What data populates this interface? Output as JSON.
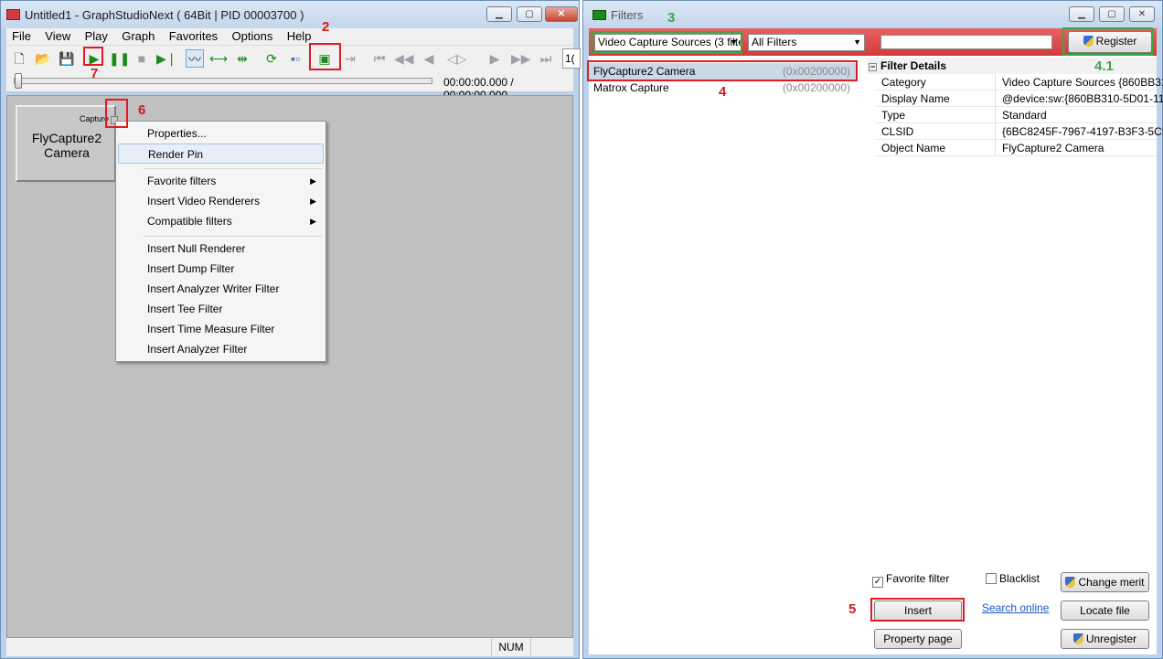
{
  "main_window": {
    "title": "Untitled1 - GraphStudioNext ( 64Bit | PID 00003700 )",
    "menu": [
      "File",
      "View",
      "Play",
      "Graph",
      "Favorites",
      "Options",
      "Help"
    ],
    "time_display": "00:00:00.000 / 00:00:00.000",
    "toolbar_overflow": "1(",
    "status": "NUM"
  },
  "filter_node": {
    "name": "FlyCapture2 Camera",
    "pin_label": "Capture"
  },
  "context_menu": {
    "items": [
      {
        "label": "Properties..."
      },
      {
        "label": "Render Pin"
      },
      {
        "label": "Favorite filters"
      },
      {
        "label": "Insert Video Renderers"
      },
      {
        "label": "Compatible filters"
      },
      {
        "label": "Insert Null Renderer"
      },
      {
        "label": "Insert Dump Filter"
      },
      {
        "label": "Insert Analyzer Writer Filter"
      },
      {
        "label": "Insert Tee Filter"
      },
      {
        "label": "Insert Time Measure Filter"
      },
      {
        "label": "Insert Analyzer Filter"
      }
    ]
  },
  "filters_window": {
    "title": "Filters",
    "category_combo": "Video Capture Sources (3 filte",
    "type_combo": "All Filters",
    "search_value": "",
    "register_label": "Register",
    "list": [
      {
        "name": "FlyCapture2 Camera",
        "merit": "(0x00200000)"
      },
      {
        "name": "Matrox Capture",
        "merit": "(0x00200000)"
      }
    ],
    "details_header": "Filter Details",
    "details": [
      {
        "key": "Category",
        "value": "Video Capture Sources {860BB310-"
      },
      {
        "key": "Display Name",
        "value": "@device:sw:{860BB310-5D01-11D0"
      },
      {
        "key": "Type",
        "value": "Standard"
      },
      {
        "key": "CLSID",
        "value": "{6BC8245F-7967-4197-B3F3-5CD16"
      },
      {
        "key": "Object Name",
        "value": "FlyCapture2 Camera"
      }
    ],
    "favorite_label": "Favorite filter",
    "blacklist_label": "Blacklist",
    "change_merit_label": "Change merit",
    "insert_label": "Insert",
    "search_online_label": "Search online",
    "locate_file_label": "Locate file",
    "property_page_label": "Property page",
    "unregister_label": "Unregister"
  },
  "annotations": {
    "a2": "2",
    "a3": "3",
    "a4": "4",
    "a41": "4.1",
    "a5": "5",
    "a6": "6",
    "a7": "7"
  },
  "colors": {
    "annotation_red": "#e01b24",
    "annotation_green": "#3aa845"
  }
}
